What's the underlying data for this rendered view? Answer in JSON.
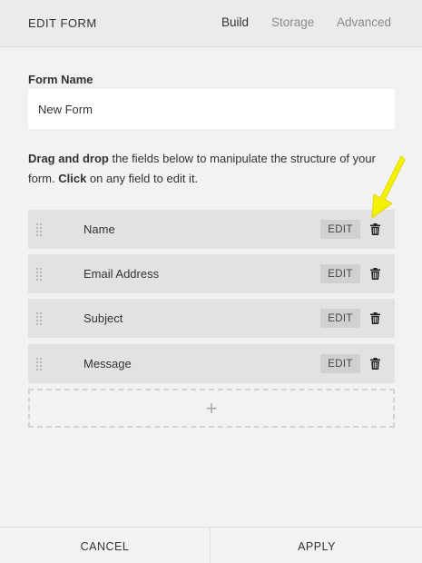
{
  "header": {
    "title": "EDIT FORM",
    "tabs": [
      {
        "label": "Build",
        "active": true
      },
      {
        "label": "Storage",
        "active": false
      },
      {
        "label": "Advanced",
        "active": false
      }
    ]
  },
  "form_name": {
    "label": "Form Name",
    "value": "New Form"
  },
  "instructions": {
    "part1_bold": "Drag and drop",
    "part2": " the fields below to manipulate the structure of your form. ",
    "part3_bold": "Click",
    "part4": " on any field to edit it."
  },
  "fields": [
    {
      "name": "Name",
      "edit_label": "EDIT"
    },
    {
      "name": "Email Address",
      "edit_label": "EDIT"
    },
    {
      "name": "Subject",
      "edit_label": "EDIT"
    },
    {
      "name": "Message",
      "edit_label": "EDIT"
    }
  ],
  "add_field": {
    "symbol": "+"
  },
  "footer": {
    "cancel_label": "CANCEL",
    "apply_label": "APPLY"
  },
  "colors": {
    "highlight_arrow": "#f5f200",
    "panel_background": "#f2f2f2",
    "field_row": "#e2e2e2"
  },
  "icons": {
    "trash": "trash-icon",
    "drag": "drag-handle-icon",
    "annotation": "yellow-arrow-icon"
  }
}
